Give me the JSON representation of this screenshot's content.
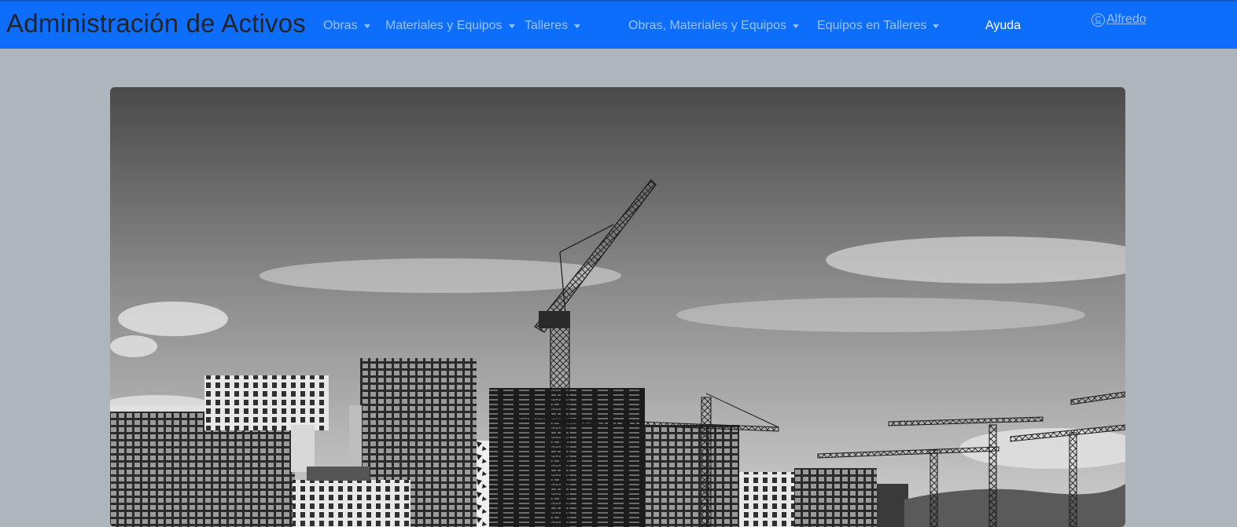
{
  "navbar": {
    "brand": "Administración de Activos",
    "items": [
      {
        "label": "Obras"
      },
      {
        "label": "Materiales y Equipos"
      },
      {
        "label": "Talleres"
      },
      {
        "label": "Obras, Materiales y Equipos"
      },
      {
        "label": "Equipos en Talleres"
      }
    ],
    "help": "Ayuda",
    "user": "Alfredo",
    "user_icon": "copyright-icon",
    "background_color": "#0d6efd"
  },
  "page": {
    "background_color": "#adb5bd"
  }
}
